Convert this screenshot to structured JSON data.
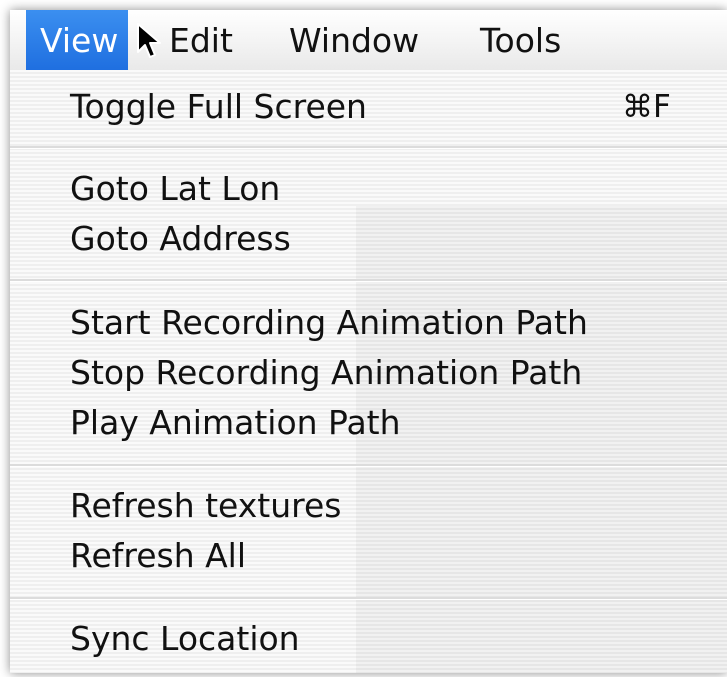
{
  "menubar": {
    "items": [
      {
        "label": "View",
        "active": true
      },
      {
        "label": "Edit",
        "active": false
      },
      {
        "label": "Window",
        "active": false
      },
      {
        "label": "Tools",
        "active": false
      }
    ]
  },
  "menu": {
    "groups": [
      [
        {
          "label": "Toggle Full Screen",
          "shortcut": "⌘F"
        }
      ],
      [
        {
          "label": "Goto Lat Lon"
        },
        {
          "label": "Goto Address"
        }
      ],
      [
        {
          "label": "Start Recording Animation Path"
        },
        {
          "label": "Stop Recording Animation Path"
        },
        {
          "label": "Play Animation Path"
        }
      ],
      [
        {
          "label": "Refresh textures"
        },
        {
          "label": "Refresh All"
        }
      ],
      [
        {
          "label": "Sync Location"
        }
      ]
    ]
  },
  "colors": {
    "highlight": "#1f6fe0",
    "menu_background": "#f4f4f4",
    "text": "#111111"
  },
  "icons": {
    "cursor": "arrow-cursor-icon"
  }
}
